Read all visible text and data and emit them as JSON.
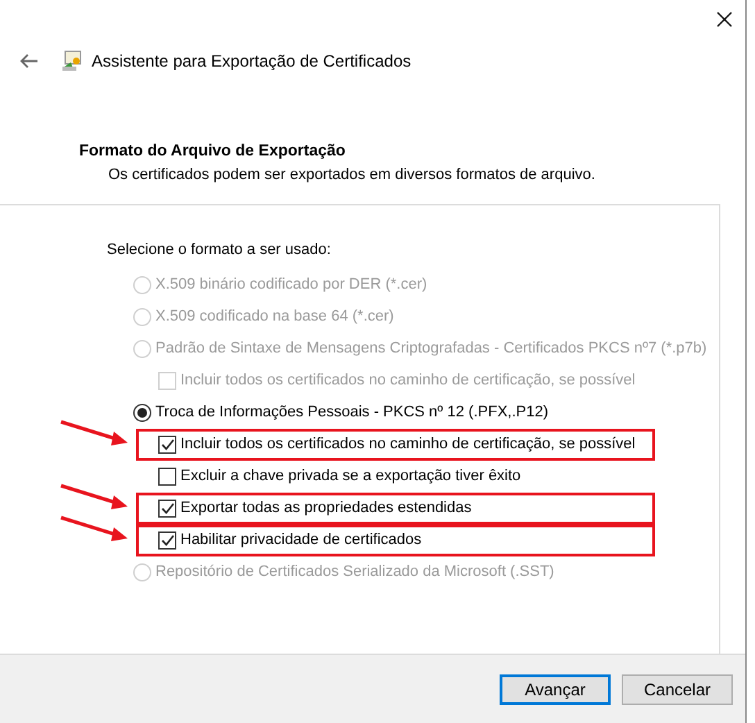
{
  "window": {
    "title": "Assistente para Exportação de Certificados"
  },
  "page": {
    "heading": "Formato do Arquivo de Exportação",
    "description": "Os certificados podem ser exportados em diversos formatos de arquivo."
  },
  "prompt": "Selecione o formato a ser usado:",
  "formats": [
    {
      "label": "X.509 binário codificado por DER (*.cer)",
      "selected": false,
      "disabled": true
    },
    {
      "label": "X.509 codificado na base 64 (*.cer)",
      "selected": false,
      "disabled": true
    },
    {
      "label": "Padrão de Sintaxe de Mensagens Criptografadas - Certificados PKCS nº7 (*.p7b)",
      "selected": false,
      "disabled": true,
      "children": [
        {
          "label": "Incluir todos os certificados no caminho de certificação, se possível",
          "checked": false,
          "disabled": true,
          "highlighted": false
        }
      ]
    },
    {
      "label": "Troca de Informações Pessoais - PKCS nº 12 (.PFX,.P12)",
      "selected": true,
      "disabled": false,
      "children": [
        {
          "label": "Incluir todos os certificados no caminho de certificação, se possível",
          "checked": true,
          "disabled": false,
          "highlighted": true
        },
        {
          "label": "Excluir a chave privada se a exportação tiver êxito",
          "checked": false,
          "disabled": false,
          "highlighted": false
        },
        {
          "label": "Exportar todas as propriedades estendidas",
          "checked": true,
          "disabled": false,
          "highlighted": true
        },
        {
          "label": "Habilitar privacidade de certificados",
          "checked": true,
          "disabled": false,
          "highlighted": true
        }
      ]
    },
    {
      "label": "Repositório de Certificados Serializado da Microsoft (.SST)",
      "selected": false,
      "disabled": true
    }
  ],
  "buttons": [
    {
      "label": "Avançar",
      "default": true
    },
    {
      "label": "Cancelar",
      "default": false
    }
  ]
}
